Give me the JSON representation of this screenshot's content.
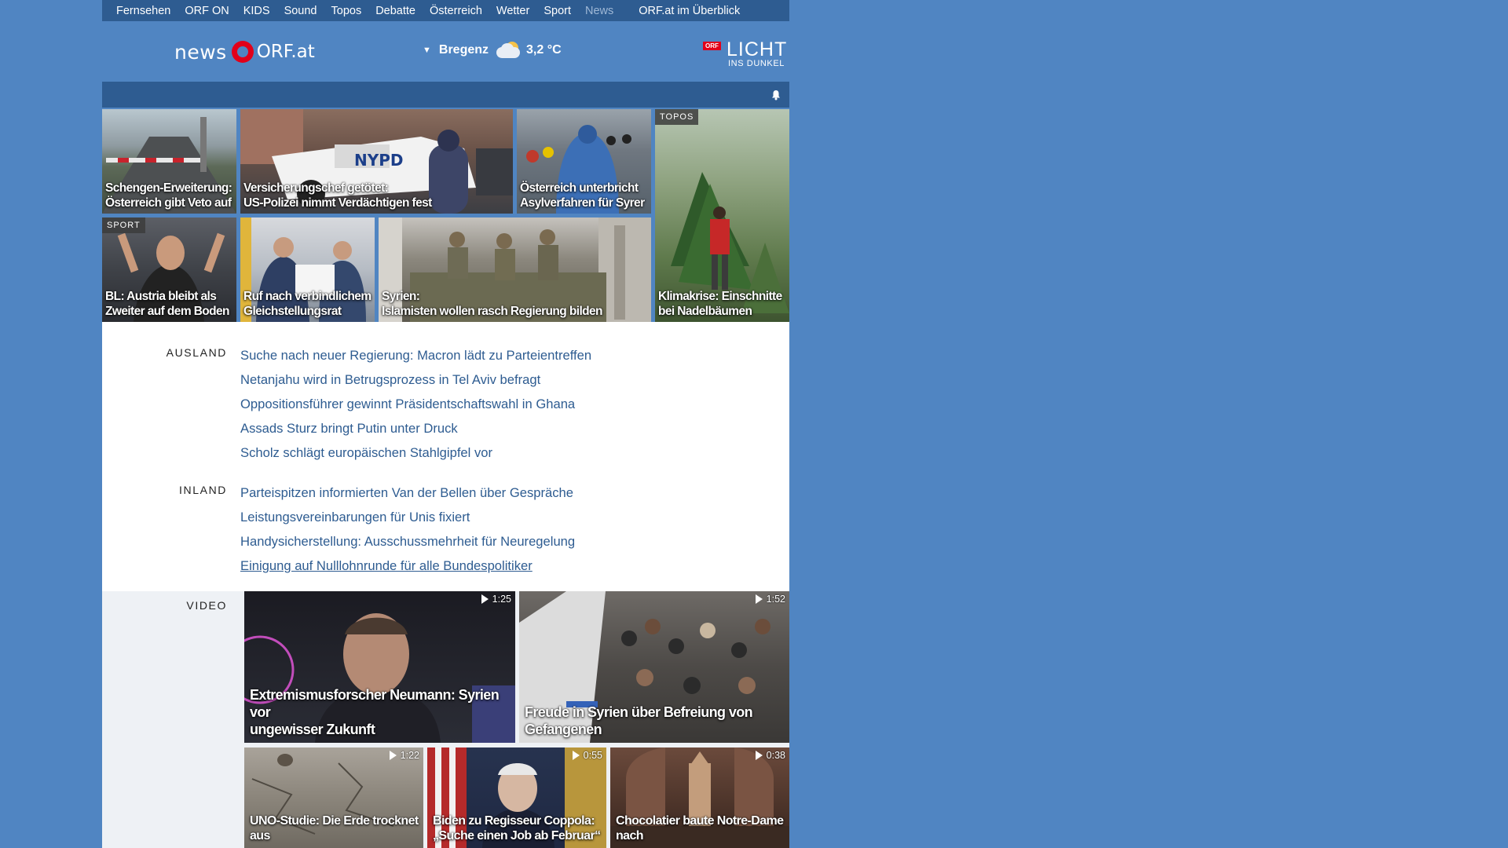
{
  "topnav": {
    "items": [
      "Fernsehen",
      "ORF ON",
      "KIDS",
      "Sound",
      "Topos",
      "Debatte",
      "Österreich",
      "Wetter",
      "Sport",
      "News"
    ],
    "overview": "ORF.at im Überblick"
  },
  "header": {
    "logo_news": "news",
    "logo_orf": "ORF.at",
    "weather": {
      "city": "Bregenz",
      "temp": "3,2 °C",
      "icon": "cloud-sun-icon"
    },
    "licht": {
      "badge": "ORF",
      "line1": "LICHT",
      "line2": "INS DUNKEL"
    }
  },
  "tiles": [
    {
      "tag": "",
      "title_1": "Schengen-Erweiterung:",
      "title_2": "Österreich gibt Veto auf"
    },
    {
      "tag": "",
      "title_1": "Versicherungschef getötet:",
      "title_2": "US-Polizei nimmt Verdächtigen fest"
    },
    {
      "tag": "",
      "title_1": "Österreich unterbricht",
      "title_2": "Asylverfahren für Syrer"
    },
    {
      "tag": "TOPOS",
      "title_1": "Klimakrise: Einschnitte",
      "title_2": "bei Nadelbäumen"
    },
    {
      "tag": "SPORT",
      "title_1": "BL: Austria bleibt als",
      "title_2": "Zweiter auf dem Boden"
    },
    {
      "tag": "",
      "title_1": "Ruf nach verbindlichem",
      "title_2": "Gleichstellungsrat"
    },
    {
      "tag": "",
      "title_1": "Syrien:",
      "title_2": "Islamisten wollen rasch Regierung bilden"
    }
  ],
  "sections": [
    {
      "label": "AUSLAND",
      "items": [
        "Suche nach neuer Regierung: Macron lädt zu Parteientreffen",
        "Netanjahu wird in Betrugsprozess in Tel Aviv befragt",
        "Oppositionsführer gewinnt Präsidentschaftswahl in Ghana",
        "Assads Sturz bringt Putin unter Druck",
        "Scholz schlägt europäischen Stahlgipfel vor"
      ]
    },
    {
      "label": "INLAND",
      "items": [
        "Parteispitzen informierten Van der Bellen über Gespräche",
        "Leistungsvereinbarungen für Unis fixiert",
        "Handysicherstellung: Ausschussmehrheit für Neuregelung",
        "Einigung auf Nulllohnrunde für alle Bundespolitiker"
      ]
    }
  ],
  "video": {
    "label": "VIDEO",
    "items": [
      {
        "duration": "1:25",
        "title_1": "Extremismusforscher Neumann: Syrien vor",
        "title_2": "ungewisser Zukunft"
      },
      {
        "duration": "1:52",
        "title_1": "Freude in Syrien über Befreiung von",
        "title_2": "Gefangenen"
      },
      {
        "duration": "1:22",
        "title_1": "UNO-Studie: Die Erde trocknet",
        "title_2": "aus"
      },
      {
        "duration": "0:55",
        "title_1": "Biden zu Regisseur Coppola:",
        "title_2": "„Suche einen Job ab Februar“"
      },
      {
        "duration": "0:38",
        "title_1": "Chocolatier baute Notre-Dame",
        "title_2": "nach"
      }
    ]
  },
  "colors": {
    "background": "#5085c2",
    "nav_bar": "#2e5c91",
    "link": "#2e5c91",
    "orf_red": "#e2001a"
  }
}
